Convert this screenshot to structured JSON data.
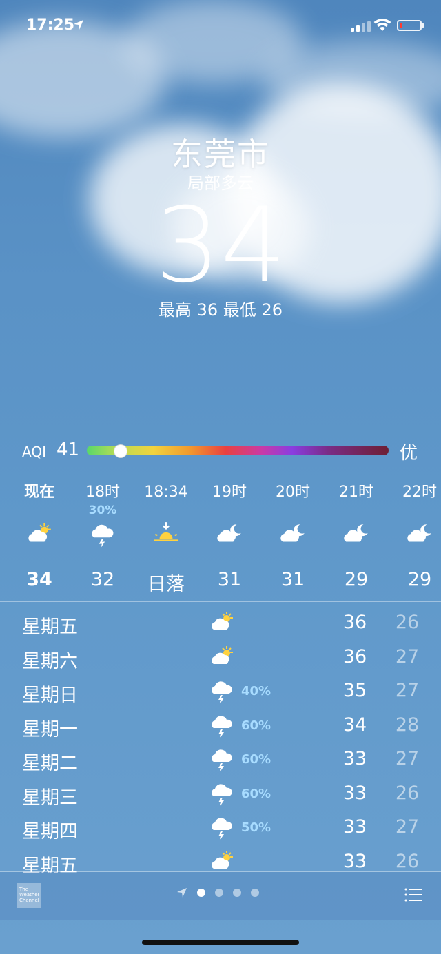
{
  "status": {
    "time": "17:25"
  },
  "weather": {
    "city": "东莞市",
    "condition": "局部多云",
    "temperature": "34",
    "hilo": "最高 36  最低 26"
  },
  "aqi": {
    "label": "AQI",
    "value": "41",
    "level": "优",
    "position_fraction": 0.11
  },
  "hourly": [
    {
      "label": "现在",
      "prob": "",
      "icon": "partly-sunny-icon",
      "temp": "34",
      "bold": true
    },
    {
      "label": "18时",
      "prob": "30%",
      "icon": "thunder-rain-icon",
      "temp": "32"
    },
    {
      "label": "18:34",
      "prob": "",
      "icon": "sunset-icon",
      "temp": "日落"
    },
    {
      "label": "19时",
      "prob": "",
      "icon": "cloudy-night-icon",
      "temp": "31"
    },
    {
      "label": "20时",
      "prob": "",
      "icon": "cloudy-night-icon",
      "temp": "31"
    },
    {
      "label": "21时",
      "prob": "",
      "icon": "cloudy-night-icon",
      "temp": "29"
    },
    {
      "label": "22时",
      "prob": "",
      "icon": "cloudy-night-icon",
      "temp": "29"
    }
  ],
  "daily": [
    {
      "day": "星期五",
      "icon": "partly-sunny-icon",
      "prob": "",
      "high": "36",
      "low": "26"
    },
    {
      "day": "星期六",
      "icon": "partly-sunny-icon",
      "prob": "",
      "high": "36",
      "low": "27"
    },
    {
      "day": "星期日",
      "icon": "thunder-rain-icon",
      "prob": "40%",
      "high": "35",
      "low": "27"
    },
    {
      "day": "星期一",
      "icon": "thunder-rain-icon",
      "prob": "60%",
      "high": "34",
      "low": "28"
    },
    {
      "day": "星期二",
      "icon": "thunder-rain-icon",
      "prob": "60%",
      "high": "33",
      "low": "27"
    },
    {
      "day": "星期三",
      "icon": "thunder-rain-icon",
      "prob": "60%",
      "high": "33",
      "low": "26"
    },
    {
      "day": "星期四",
      "icon": "thunder-rain-icon",
      "prob": "50%",
      "high": "33",
      "low": "27"
    },
    {
      "day": "星期五",
      "icon": "partly-sunny-icon",
      "prob": "",
      "high": "33",
      "low": "26"
    }
  ],
  "footer": {
    "provider_logo": "The Weather Channel",
    "page_count": 4,
    "active_page": 0
  }
}
